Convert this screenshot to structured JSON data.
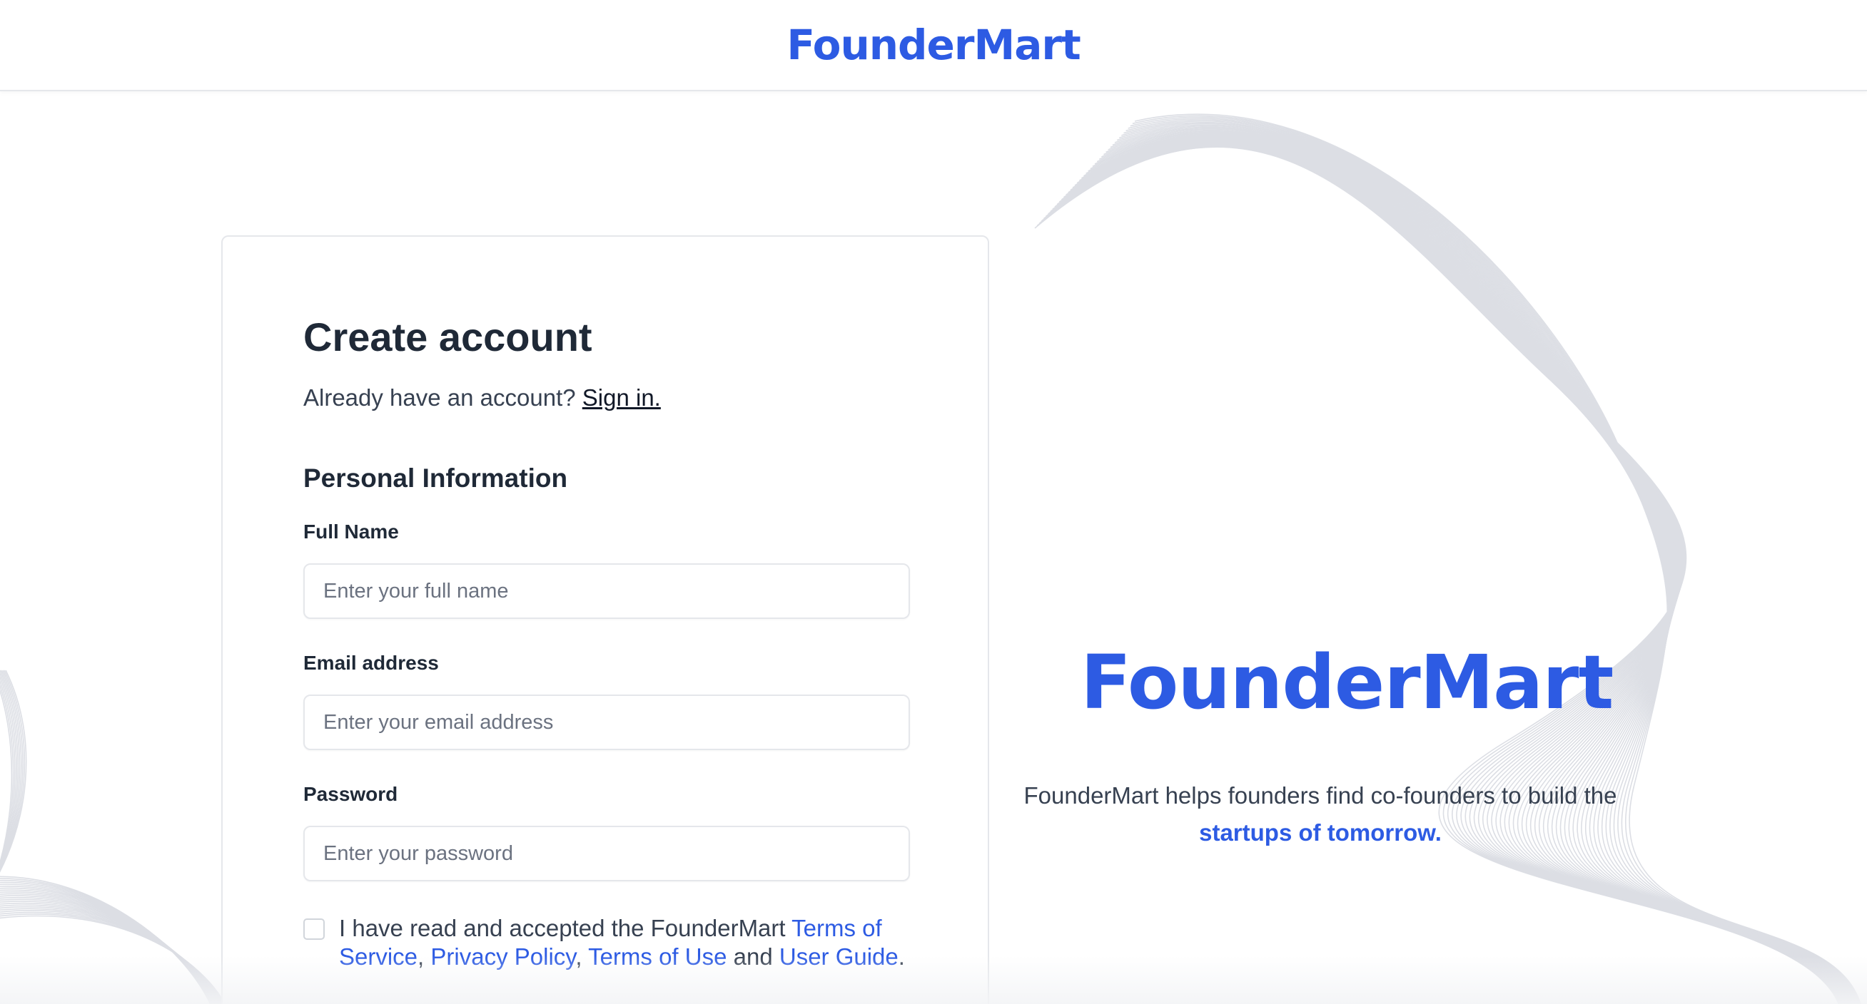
{
  "header": {
    "brand": "FounderMart"
  },
  "form": {
    "title": "Create account",
    "signin_prompt": "Already have an account?",
    "signin_link": "Sign in.",
    "section_title": "Personal Information",
    "full_name": {
      "label": "Full Name",
      "placeholder": "Enter your full name",
      "value": ""
    },
    "email": {
      "label": "Email address",
      "placeholder": "Enter your email address",
      "value": ""
    },
    "password": {
      "label": "Password",
      "placeholder": "Enter your password",
      "value": ""
    },
    "terms": {
      "checked": false,
      "prefix": "I have read and accepted the FounderMart",
      "link_terms_of_service": "Terms of Service",
      "sep1": ",",
      "link_privacy_policy": "Privacy Policy",
      "sep2": ",",
      "link_terms_of_use": "Terms of Use",
      "and": "and",
      "link_user_guide": "User Guide",
      "end": "."
    }
  },
  "hero": {
    "brand": "FounderMart",
    "description_prefix": "FounderMart helps founders find co-founders to build the",
    "description_highlight": "startups of tomorrow."
  },
  "colors": {
    "brand_blue": "#2d5be3",
    "text_dark": "#1f2937",
    "border": "#e5e7eb",
    "wave_stroke": "#d6d9e0"
  }
}
